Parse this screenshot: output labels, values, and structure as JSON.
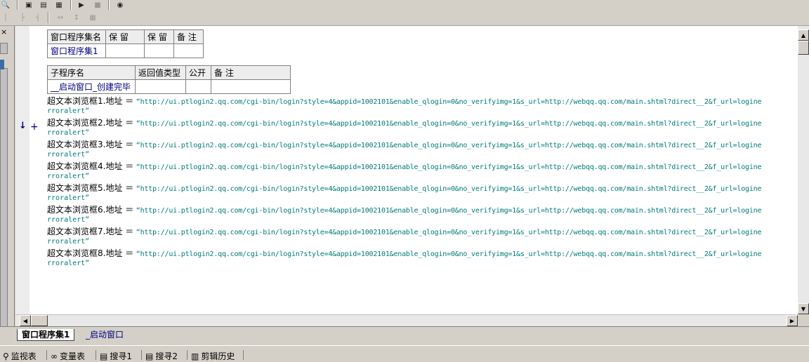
{
  "toolbar": {
    "icons": [
      "find-icon",
      "layout-icon",
      "split-horizontal-icon",
      "split-vertical-icon",
      "run-icon",
      "stop-icon",
      "binoculars-icon"
    ]
  },
  "assembly_table": {
    "headers": [
      "窗口程序集名",
      "保 留",
      "保 留",
      "备 注"
    ],
    "row": [
      "窗口程序集1",
      "",
      "",
      ""
    ]
  },
  "sub_table": {
    "headers": [
      "子程序名",
      "返回值类型",
      "公开",
      "备 注"
    ],
    "row": [
      "__启动窗口_创建完毕",
      "",
      "",
      ""
    ]
  },
  "gutter": {
    "arrow": "↓",
    "plus": "+"
  },
  "code_lines": [
    {
      "lhs": "超文本浏览框1.地址 ＝",
      "url": "“http://ui.ptlogin2.qq.com/cgi-bin/login?style=4&appid=1002101&enable_qlogin=0&no_verifyimg=1&s_url=http://webqq.qq.com/main.shtml?direct__2&f_url=logine",
      "cont": "rroralert”"
    },
    {
      "lhs": "超文本浏览框2.地址 ＝",
      "url": "“http://ui.ptlogin2.qq.com/cgi-bin/login?style=4&appid=1002101&enable_qlogin=0&no_verifyimg=1&s_url=http://webqq.qq.com/main.shtml?direct__2&f_url=logine",
      "cont": "rroralert”"
    },
    {
      "lhs": "超文本浏览框3.地址 ＝",
      "url": "“http://ui.ptlogin2.qq.com/cgi-bin/login?style=4&appid=1002101&enable_qlogin=0&no_verifyimg=1&s_url=http://webqq.qq.com/main.shtml?direct__2&f_url=logine",
      "cont": "rroralert”"
    },
    {
      "lhs": "超文本浏览框4.地址 ＝",
      "url": "“http://ui.ptlogin2.qq.com/cgi-bin/login?style=4&appid=1002101&enable_qlogin=0&no_verifyimg=1&s_url=http://webqq.qq.com/main.shtml?direct__2&f_url=logine",
      "cont": "rroralert”"
    },
    {
      "lhs": "超文本浏览框5.地址 ＝",
      "url": "“http://ui.ptlogin2.qq.com/cgi-bin/login?style=4&appid=1002101&enable_qlogin=0&no_verifyimg=1&s_url=http://webqq.qq.com/main.shtml?direct__2&f_url=logine",
      "cont": "rroralert”"
    },
    {
      "lhs": "超文本浏览框6.地址 ＝",
      "url": "“http://ui.ptlogin2.qq.com/cgi-bin/login?style=4&appid=1002101&enable_qlogin=0&no_verifyimg=1&s_url=http://webqq.qq.com/main.shtml?direct__2&f_url=logine",
      "cont": "rroralert”"
    },
    {
      "lhs": "超文本浏览框7.地址 ＝",
      "url": "“http://ui.ptlogin2.qq.com/cgi-bin/login?style=4&appid=1002101&enable_qlogin=0&no_verifyimg=1&s_url=http://webqq.qq.com/main.shtml?direct__2&f_url=logine",
      "cont": "rroralert”"
    },
    {
      "lhs": "超文本浏览框8.地址 ＝",
      "url": "“http://ui.ptlogin2.qq.com/cgi-bin/login?style=4&appid=1002101&enable_qlogin=0&no_verifyimg=1&s_url=http://webqq.qq.com/main.shtml?direct__2&f_url=logine",
      "cont": "rroralert”"
    }
  ],
  "tabs": [
    {
      "label": "窗口程序集1",
      "active": true
    },
    {
      "label": "_启动窗口",
      "active": false
    }
  ],
  "bottom_tabs": [
    {
      "label": "监视表",
      "icon": "magnifier-icon"
    },
    {
      "label": "变量表",
      "icon": "glasses-icon"
    },
    {
      "label": "搜寻1",
      "icon": "search-list-icon"
    },
    {
      "label": "搜寻2",
      "icon": "search-list-icon"
    },
    {
      "label": "剪辑历史",
      "icon": "clipboard-icon"
    }
  ],
  "left_panel": {
    "close": "×"
  },
  "colors": {
    "code_string": "#007a7a",
    "link_navy": "#000080",
    "background": "#d4d0c8"
  }
}
